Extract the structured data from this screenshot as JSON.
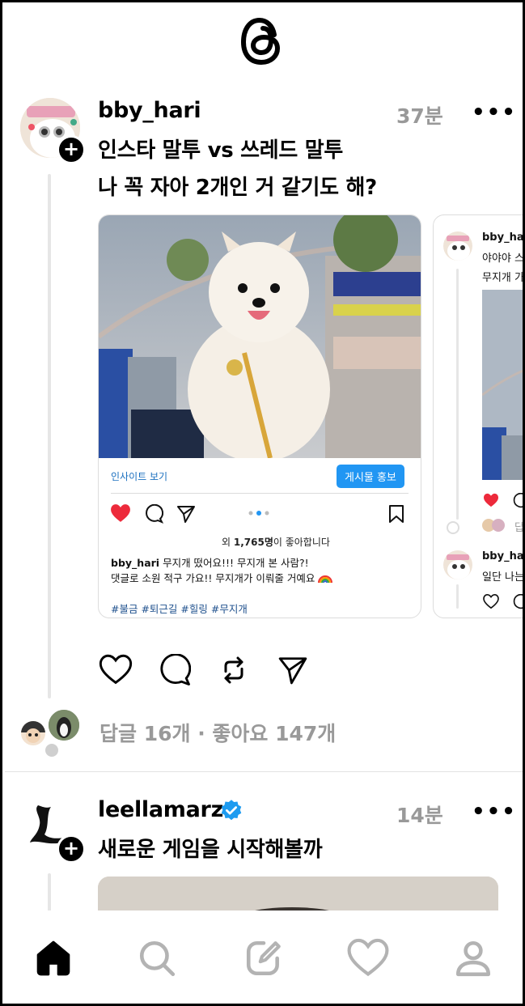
{
  "app": {
    "logo_icon": "threads-logo-icon"
  },
  "post1": {
    "username": "bby_hari",
    "time": "37분",
    "more": "•••",
    "text_line1": "인스타 말투 vs 쓰레드 말투",
    "text_line2": "나 꼭 자아 2개인 거 같기도 해?",
    "card1": {
      "insight_label": "인사이트 보기",
      "promote_label": "게시물 홍보",
      "likes_prefix": "외 ",
      "likes_count": "1,765명",
      "likes_suffix": "이 좋아합니다",
      "caption_user": "bby_hari",
      "caption_line1": "무지개 떴어요!!! 무지개 본 사람?!",
      "caption_line2": "댓글로 소원 적구 가요!! 무지개가 이뤄줄 거예요",
      "hashtags": "#불금 #퇴근길 #힐링 #무지개"
    },
    "card2": {
      "username": "bby_ha",
      "line1": "야야야 스",
      "line2": "무지개 가",
      "reply_label": "답",
      "reply_username": "bby_ha",
      "reply_text": "일단 나는"
    },
    "stats": "답글 16개 · 좋아요 147개"
  },
  "post2": {
    "username": "leellamarz",
    "time": "14분",
    "more": "•••",
    "text": "새로운 게임을 시작해볼까"
  },
  "nav": {
    "items": [
      "home-icon",
      "search-icon",
      "compose-icon",
      "activity-heart-icon",
      "profile-icon"
    ]
  },
  "colors": {
    "accent": "#2196f3",
    "like_red": "#ed2a3b",
    "verified": "#1d9bf0",
    "muted": "#999999"
  }
}
